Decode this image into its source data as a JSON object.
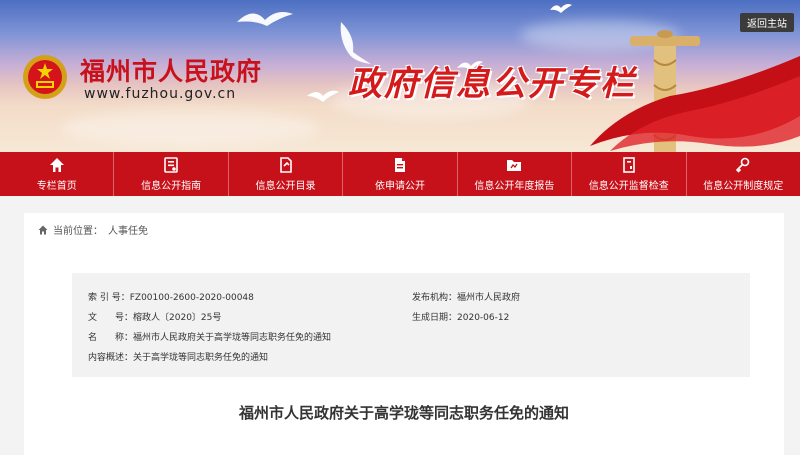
{
  "header": {
    "site_title": "福州市人民政府",
    "site_url": "www.fuzhou.gov.cn",
    "column_title": "政府信息公开专栏",
    "back_home": "返回主站"
  },
  "nav": {
    "items": [
      {
        "label": "专栏首页",
        "icon": "home-icon"
      },
      {
        "label": "信息公开指南",
        "icon": "guide-icon"
      },
      {
        "label": "信息公开目录",
        "icon": "catalog-icon"
      },
      {
        "label": "依申请公开",
        "icon": "document-icon"
      },
      {
        "label": "信息公开年度报告",
        "icon": "folder-icon"
      },
      {
        "label": "信息公开监督检查",
        "icon": "inspect-icon"
      },
      {
        "label": "信息公开制度规定",
        "icon": "regulation-icon"
      }
    ]
  },
  "breadcrumb": {
    "prefix": "当前位置：",
    "current": "人事任免"
  },
  "meta": {
    "index_label": "索 引 号：",
    "index_value": "FZ00100-2600-2020-00048",
    "publisher_label": "发布机构：",
    "publisher_value": "福州市人民政府",
    "docno_label": "文　　号：",
    "docno_value": "榕政人〔2020〕25号",
    "date_label": "生成日期：",
    "date_value": "2020-06-12",
    "name_label": "名　　称：",
    "name_value": "福州市人民政府关于高学珑等同志职务任免的通知",
    "summary_label": "内容概述：",
    "summary_value": "关于高学珑等同志职务任免的通知"
  },
  "document": {
    "title": "福州市人民政府关于高学珑等同志职务任免的通知"
  },
  "colors": {
    "brand_red": "#c7111a",
    "title_red": "#d41a1a"
  }
}
